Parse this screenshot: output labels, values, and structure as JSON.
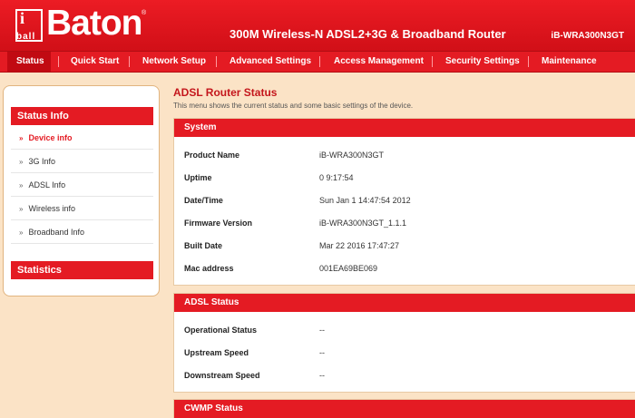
{
  "header": {
    "logo_i": "i",
    "logo_ball": "ball",
    "logo_brand": "Baton",
    "logo_reg": "®",
    "title": "300M Wireless-N ADSL2+3G & Broadband Router",
    "model": "iB-WRA300N3GT"
  },
  "nav": {
    "items": [
      {
        "label": "Status"
      },
      {
        "label": "Quick Start"
      },
      {
        "label": "Network Setup"
      },
      {
        "label": "Advanced Settings"
      },
      {
        "label": "Access Management"
      },
      {
        "label": "Security Settings"
      },
      {
        "label": "Maintenance"
      }
    ],
    "active": "Status"
  },
  "sidebar": {
    "status_info_label": "Status Info",
    "items": [
      {
        "label": "Device info"
      },
      {
        "label": "3G Info"
      },
      {
        "label": "ADSL Info"
      },
      {
        "label": "Wireless info"
      },
      {
        "label": "Broadband Info"
      }
    ],
    "statistics_label": "Statistics",
    "bullet": "»"
  },
  "main": {
    "title": "ADSL Router Status",
    "description": "This menu shows the current status and some basic settings of the device.",
    "system": {
      "header": "System",
      "rows": [
        {
          "label": "Product Name",
          "value": "iB-WRA300N3GT"
        },
        {
          "label": "Uptime",
          "value": "0 9:17:54"
        },
        {
          "label": "Date/Time",
          "value": "Sun Jan 1 14:47:54 2012"
        },
        {
          "label": "Firmware Version",
          "value": "iB-WRA300N3GT_1.1.1"
        },
        {
          "label": "Built Date",
          "value": "Mar 22 2016 17:47:27"
        },
        {
          "label": "Mac address",
          "value": "001EA69BE069"
        }
      ]
    },
    "adsl": {
      "header": "ADSL Status",
      "rows": [
        {
          "label": "Operational Status",
          "value": "--"
        },
        {
          "label": "Upstream Speed",
          "value": "--"
        },
        {
          "label": "Downstream Speed",
          "value": "--"
        }
      ]
    },
    "cwmp": {
      "header": "CWMP Status"
    }
  },
  "colors": {
    "brand_red": "#e41b23",
    "page_bg": "#fbe3c6",
    "title_red": "#c4161c"
  }
}
